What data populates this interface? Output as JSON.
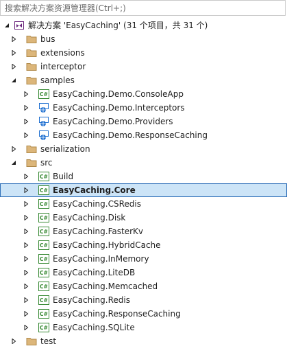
{
  "search": {
    "placeholder": "搜索解决方案资源管理器(Ctrl+;)"
  },
  "solution": {
    "label": "解决方案 'EasyCaching' (31 个项目，共 31 个)",
    "icon": "solution-icon"
  },
  "items": [
    {
      "label": "bus",
      "type": "folder",
      "level": 0,
      "expanded": false
    },
    {
      "label": "extensions",
      "type": "folder",
      "level": 0,
      "expanded": false
    },
    {
      "label": "interceptor",
      "type": "folder",
      "level": 0,
      "expanded": false
    },
    {
      "label": "samples",
      "type": "folder",
      "level": 0,
      "expanded": true
    },
    {
      "label": "EasyCaching.Demo.ConsoleApp",
      "type": "csproj",
      "level": 1,
      "expanded": false
    },
    {
      "label": "EasyCaching.Demo.Interceptors",
      "type": "webproj",
      "level": 1,
      "expanded": false
    },
    {
      "label": "EasyCaching.Demo.Providers",
      "type": "webproj",
      "level": 1,
      "expanded": false
    },
    {
      "label": "EasyCaching.Demo.ResponseCaching",
      "type": "webproj",
      "level": 1,
      "expanded": false
    },
    {
      "label": "serialization",
      "type": "folder",
      "level": 0,
      "expanded": false
    },
    {
      "label": "src",
      "type": "folder",
      "level": 0,
      "expanded": true
    },
    {
      "label": "Build",
      "type": "csproj",
      "level": 1,
      "expanded": false
    },
    {
      "label": "EasyCaching.Core",
      "type": "csproj",
      "level": 1,
      "expanded": false,
      "selected": true
    },
    {
      "label": "EasyCaching.CSRedis",
      "type": "csproj",
      "level": 1,
      "expanded": false
    },
    {
      "label": "EasyCaching.Disk",
      "type": "csproj",
      "level": 1,
      "expanded": false
    },
    {
      "label": "EasyCaching.FasterKv",
      "type": "csproj",
      "level": 1,
      "expanded": false
    },
    {
      "label": "EasyCaching.HybridCache",
      "type": "csproj",
      "level": 1,
      "expanded": false
    },
    {
      "label": "EasyCaching.InMemory",
      "type": "csproj",
      "level": 1,
      "expanded": false
    },
    {
      "label": "EasyCaching.LiteDB",
      "type": "csproj",
      "level": 1,
      "expanded": false
    },
    {
      "label": "EasyCaching.Memcached",
      "type": "csproj",
      "level": 1,
      "expanded": false
    },
    {
      "label": "EasyCaching.Redis",
      "type": "csproj",
      "level": 1,
      "expanded": false
    },
    {
      "label": "EasyCaching.ResponseCaching",
      "type": "csproj",
      "level": 1,
      "expanded": false
    },
    {
      "label": "EasyCaching.SQLite",
      "type": "csproj",
      "level": 1,
      "expanded": false
    },
    {
      "label": "test",
      "type": "folder",
      "level": 0,
      "expanded": false
    }
  ],
  "colors": {
    "selection": "#cce4f7",
    "selection_border": "#2f6fb8",
    "folder": "#dcb67a",
    "csharp": "#388a34",
    "web": "#1e6fd0"
  }
}
